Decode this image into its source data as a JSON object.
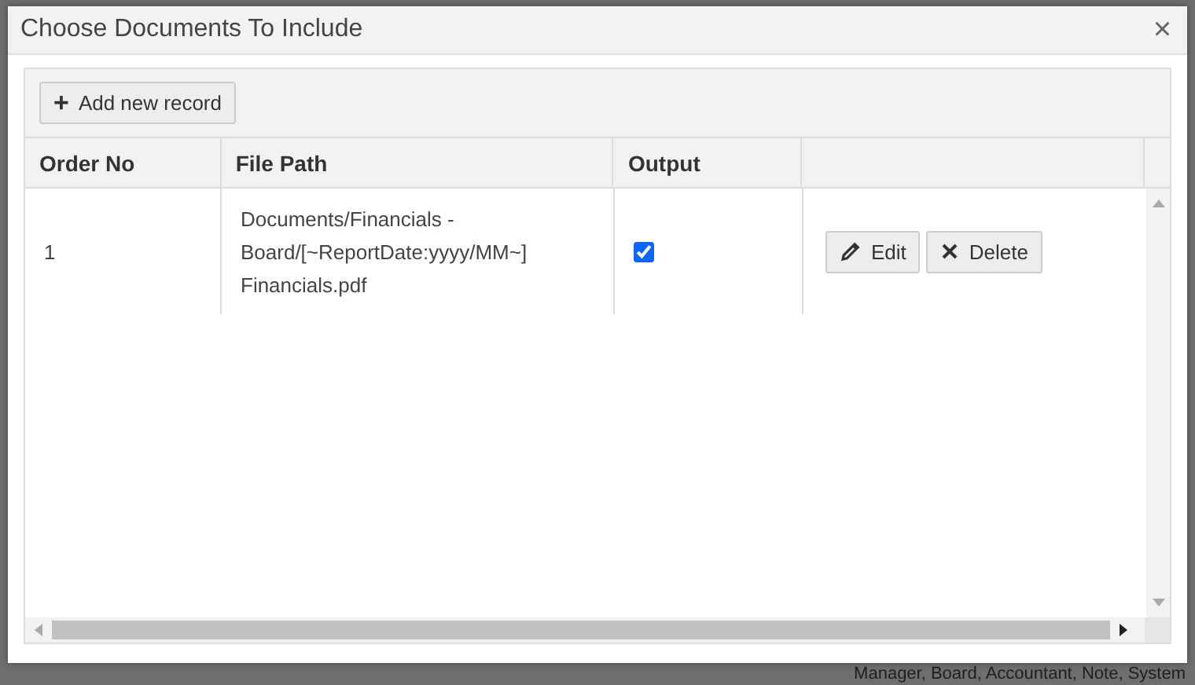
{
  "background_text": "Manager, Board, Accountant, Note, System",
  "dialog": {
    "title": "Choose Documents To Include",
    "close": "×"
  },
  "toolbar": {
    "add_button": {
      "icon": "+",
      "label": "Add new record"
    }
  },
  "table": {
    "columns": [
      "Order No",
      "File Path",
      "Output"
    ],
    "rows": [
      {
        "order_no": "1",
        "file_path": "Documents/Financials - Board/[~ReportDate:yyyy/MM~] Financials.pdf",
        "output": true,
        "actions": [
          "Edit",
          "Delete"
        ]
      }
    ]
  }
}
